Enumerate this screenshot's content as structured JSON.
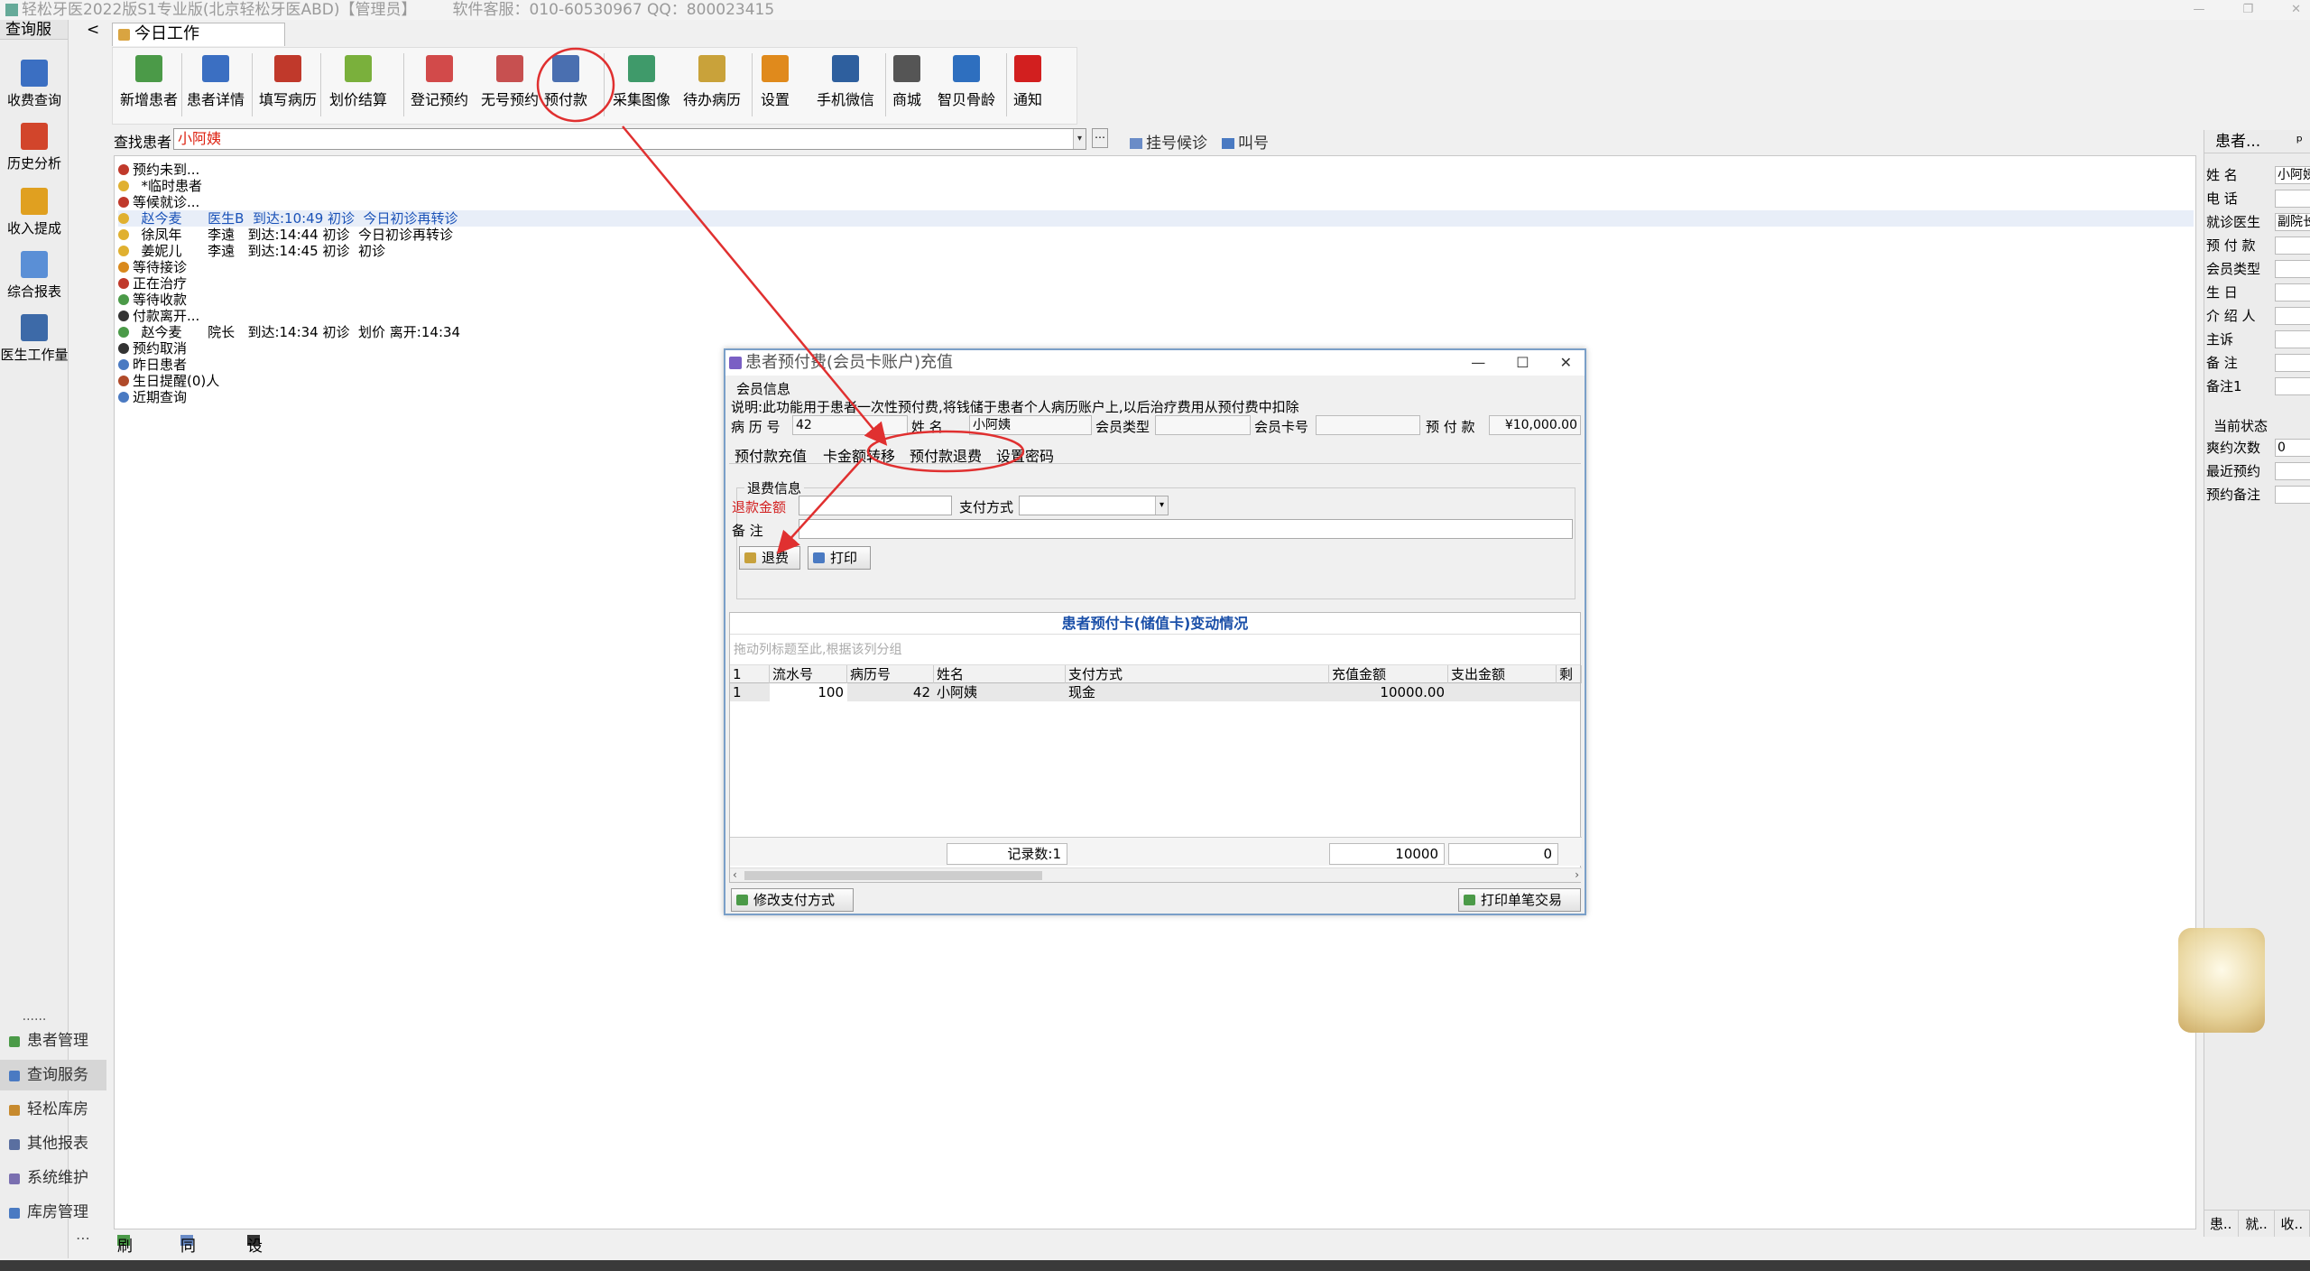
{
  "app": {
    "title": "轻松牙医2022版S1专业版(北京轻松牙医ABD)【管理员】",
    "service": "软件客服：010-60530967 QQ：800023415"
  },
  "left_nav": {
    "header": "查询服",
    "header_arrow": "<",
    "items": [
      {
        "label": "收费查询",
        "color": "#3b6fc2"
      },
      {
        "label": "历史分析",
        "color": "#d2452b"
      },
      {
        "label": "收入提成",
        "color": "#e0a020"
      },
      {
        "label": "综合报表",
        "color": "#5a8fd6"
      },
      {
        "label": "医生工作量",
        "color": "#3d6aa8"
      }
    ],
    "dots": "......",
    "modules": [
      {
        "label": "患者管理",
        "color": "#4b9a48"
      },
      {
        "label": "查询服务",
        "color": "#4a7ac2"
      },
      {
        "label": "轻松库房",
        "color": "#c78a2e"
      },
      {
        "label": "其他报表",
        "color": "#5a6fa0"
      },
      {
        "label": "系统维护",
        "color": "#7a6fb0"
      },
      {
        "label": "库房管理",
        "color": "#4a7ac2"
      }
    ],
    "more": "⋯"
  },
  "tab": {
    "label": "今日工作"
  },
  "toolbar": [
    {
      "label": "新增患者",
      "color": "#4b9a48"
    },
    {
      "label": "患者详情",
      "color": "#3b6fc2"
    },
    {
      "label": "填写病历",
      "color": "#c0392b"
    },
    {
      "label": "划价结算",
      "color": "#7ab03c"
    },
    {
      "label": "登记预约",
      "color": "#d24a4a"
    },
    {
      "label": "无号预约",
      "color": "#c75050"
    },
    {
      "label": "预付款",
      "color": "#4a6fb0"
    },
    {
      "label": "采集图像",
      "color": "#3f9a6a"
    },
    {
      "label": "待办病历",
      "color": "#c9a23a"
    },
    {
      "label": "设置",
      "color": "#e08a1c"
    },
    {
      "label": "手机微信",
      "color": "#2e5f9e"
    },
    {
      "label": "商城",
      "color": "#555555"
    },
    {
      "label": "智贝骨龄",
      "color": "#2e6fbf"
    },
    {
      "label": "通知",
      "color": "#d21f1f"
    }
  ],
  "search": {
    "label": "查找患者",
    "value": "小阿姨",
    "dd": "▾",
    "btn": "⋯",
    "link1": "挂号候诊",
    "link2": "叫号"
  },
  "tree": [
    {
      "text": "预约未到...",
      "color": "#c0392b"
    },
    {
      "text": "  *临时患者",
      "color": "#e0b030"
    },
    {
      "text": "等候就诊...",
      "color": "#c0392b"
    },
    {
      "text": "  赵今麦      医生B  到达:10:49 初诊  今日初诊再转诊",
      "color": "#e0b030",
      "sel": true
    },
    {
      "text": "  徐凤年      李遠   到达:14:44 初诊  今日初诊再转诊",
      "color": "#e0b030"
    },
    {
      "text": "  姜妮儿      李遠   到达:14:45 初诊  初诊",
      "color": "#e0b030"
    },
    {
      "text": "等待接诊",
      "color": "#d9891c"
    },
    {
      "text": "正在治疗",
      "color": "#c0392b"
    },
    {
      "text": "等待收款",
      "color": "#4b9a48"
    },
    {
      "text": "付款离开...",
      "color": "#333333"
    },
    {
      "text": "  赵今麦      院长   到达:14:34 初诊  划价 离开:14:34",
      "color": "#4b9a48"
    },
    {
      "text": "预约取消",
      "color": "#333333"
    },
    {
      "text": "昨日患者",
      "color": "#4a7ac2"
    },
    {
      "text": "生日提醒(0)人",
      "color": "#b04a2a"
    },
    {
      "text": "近期查询",
      "color": "#4a7ac2"
    }
  ],
  "right_panel": {
    "header": "患者...",
    "pin": "ᵖ",
    "rows": [
      {
        "label": "姓    名",
        "value": "小阿姨"
      },
      {
        "label": "电    话",
        "value": ""
      },
      {
        "label": "就诊医生",
        "value": "副院长"
      },
      {
        "label": "预 付 款",
        "value": ""
      },
      {
        "label": "会员类型",
        "value": ""
      },
      {
        "label": "生    日",
        "value": ""
      },
      {
        "label": "介 绍 人",
        "value": ""
      },
      {
        "label": "     主诉",
        "value": ""
      },
      {
        "label": "备    注",
        "value": ""
      },
      {
        "label": "备注1",
        "value": ""
      }
    ],
    "state_header": "当前状态",
    "state_rows": [
      {
        "label": "爽约次数",
        "value": "0"
      },
      {
        "label": "最近预约",
        "value": ""
      },
      {
        "label": "预约备注",
        "value": ""
      }
    ],
    "tabs": [
      "患..",
      "就..",
      "收.."
    ]
  },
  "status_bar": {
    "refresh": "刷新",
    "sync": "同步",
    "away": "设离开"
  },
  "dialog": {
    "title": "患者预付费(会员卡账户)充值",
    "section": "会员信息",
    "description": "说明:此功能用于患者一次性预付费,将钱储于患者个人病历账户上,以后治疗费用从预付费中扣除",
    "fields": {
      "record_no_label": "病 历 号",
      "record_no": "42",
      "name_label": "姓    名",
      "name": "小阿姨",
      "member_type_label": "会员类型",
      "member_type": "",
      "card_no_label": "会员卡号",
      "card_no": "",
      "prepaid_label": "预 付 款",
      "prepaid": "¥10,000.00"
    },
    "tabs": [
      "预付款充值",
      "卡金额转移",
      "预付款退费",
      "设置密码"
    ],
    "refund": {
      "group": "退费信息",
      "amount_label": "退款金额",
      "amount_value": "",
      "pay_label": "支付方式",
      "pay_value": "",
      "note_label": "备    注",
      "note_value": "",
      "refund_btn": "退费",
      "print_btn": "打印"
    },
    "grid": {
      "title": "患者预付卡(储值卡)变动情况",
      "group_hint": "拖动列标题至此,根据该列分组",
      "columns": [
        "1",
        "流水号",
        "病历号",
        "姓名",
        "支付方式",
        "充值金额",
        "支出金额",
        "剩余"
      ],
      "rows": [
        {
          "idx": "1",
          "serial": "100",
          "record": "42",
          "name": "小阿姨",
          "pay": "现金",
          "deposit": "10000.00",
          "spend": ""
        }
      ],
      "footer": {
        "count": "记录数:1",
        "deposit_total": "10000",
        "spend_total": "0"
      }
    },
    "bottom": {
      "change_pay": "修改支付方式",
      "print_single": "打印单笔交易"
    }
  },
  "colors": {
    "annotation": "#e03030",
    "accent": "#1a4fa8"
  }
}
